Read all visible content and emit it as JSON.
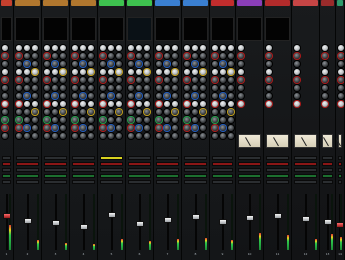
{
  "app": {
    "window_title": ""
  },
  "colors": {
    "bg": "#101214",
    "accent_red": "#b01919",
    "accent_green": "#1c6f2f",
    "accent_yellow": "#d8d21f",
    "accent_blue": "#1f5cc2"
  },
  "strips": [
    {
      "id": "1",
      "header": "",
      "header_color": "#c6402e",
      "label1": "",
      "label2": "",
      "display": [
        "",
        ""
      ],
      "type": "full",
      "fader_value": 0.62,
      "meter": 0.45,
      "fader_color": "red"
    },
    {
      "id": "2",
      "header": "",
      "header_color": "#b1772e",
      "label1": "",
      "label2": "",
      "display": [
        "",
        ""
      ],
      "type": "full",
      "fader_value": 0.52,
      "meter": 0.18,
      "fader_color": "white"
    },
    {
      "id": "3",
      "header": "",
      "header_color": "#b1772e",
      "label1": "",
      "label2": "",
      "display": [
        "",
        ""
      ],
      "type": "full",
      "fader_value": 0.48,
      "meter": 0.12,
      "fader_color": "white"
    },
    {
      "id": "4",
      "header": "",
      "header_color": "#b1772e",
      "label1": "",
      "label2": "",
      "display": [
        "",
        ""
      ],
      "type": "full",
      "fader_value": 0.4,
      "meter": 0.1,
      "fader_color": "white"
    },
    {
      "id": "5",
      "header": "",
      "header_color": "#3ec24f",
      "label1": "",
      "label2": "",
      "display": [
        "",
        ""
      ],
      "type": "full",
      "fader_value": 0.64,
      "meter": 0.2,
      "fader_color": "white"
    },
    {
      "id": "6",
      "header": "",
      "header_color": "#3ec24f",
      "label1": "",
      "label2": "",
      "display": [
        "",
        ""
      ],
      "type": "full",
      "fader_value": 0.46,
      "meter": 0.16,
      "fader_color": "white"
    },
    {
      "id": "7",
      "header": "",
      "header_color": "#3a7fd1",
      "label1": "",
      "label2": "",
      "display": [
        "",
        ""
      ],
      "type": "full",
      "fader_value": 0.54,
      "meter": 0.2,
      "fader_color": "white"
    },
    {
      "id": "8",
      "header": "",
      "header_color": "#3a7fd1",
      "label1": "",
      "label2": "",
      "display": [
        "",
        ""
      ],
      "type": "full",
      "fader_value": 0.6,
      "meter": 0.22,
      "fader_color": "white"
    },
    {
      "id": "9",
      "header": "",
      "header_color": "#c22d2d",
      "label1": "",
      "label2": "",
      "display": [
        "",
        ""
      ],
      "type": "full",
      "fader_value": 0.5,
      "meter": 0.18,
      "fader_color": "white"
    },
    {
      "id": "10",
      "header": "",
      "header_color": "#8a3eb8",
      "label1": "",
      "label2": "",
      "display": [
        "",
        ""
      ],
      "type": "return",
      "fader_value": 0.58,
      "meter": 0.3,
      "fader_color": "white"
    },
    {
      "id": "11",
      "header": "",
      "header_color": "#b22b2b",
      "label1": "",
      "label2": "",
      "display": [
        "",
        ""
      ],
      "type": "return",
      "fader_value": 0.62,
      "meter": 0.26,
      "fader_color": "white"
    },
    {
      "id": "12",
      "header": "",
      "header_color": "#c64545",
      "label1": "",
      "label2": "",
      "display": [
        "",
        ""
      ],
      "type": "return",
      "fader_value": 0.56,
      "meter": 0.2,
      "fader_color": "white"
    },
    {
      "id": "13",
      "header": "",
      "header_color": "#9a2b2b",
      "label1": "",
      "label2": "",
      "display": [
        "",
        ""
      ],
      "type": "return",
      "fader_value": 0.5,
      "meter": 0.28,
      "fader_color": "white"
    },
    {
      "id": "14",
      "header": "",
      "header_color": "#2f9a6b",
      "label1": "",
      "label2": "",
      "display": [
        "",
        ""
      ],
      "type": "bus",
      "fader_value": 0.44,
      "meter": 0.24,
      "fader_color": "red"
    }
  ]
}
